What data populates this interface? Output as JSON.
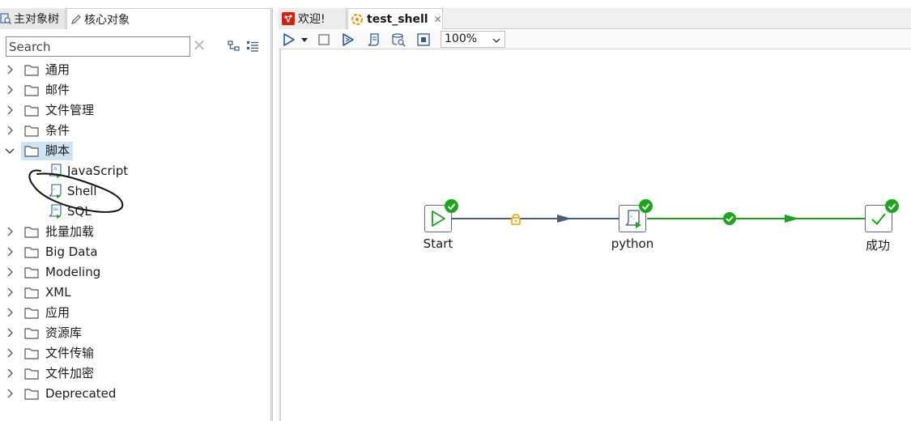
{
  "left_panel": {
    "tabs": [
      {
        "label": "主对象树",
        "icon": "tree-search-icon"
      },
      {
        "label": "核心对象",
        "icon": "pencil-icon"
      }
    ],
    "search": {
      "placeholder": "Search",
      "value": ""
    },
    "tree": [
      {
        "label": "通用",
        "expanded": false
      },
      {
        "label": "邮件",
        "expanded": false
      },
      {
        "label": "文件管理",
        "expanded": false
      },
      {
        "label": "条件",
        "expanded": false
      },
      {
        "label": "脚本",
        "expanded": true,
        "selected": true,
        "children": [
          {
            "label": "JavaScript",
            "icon": "javascript-script-icon"
          },
          {
            "label": "Shell",
            "icon": "shell-script-icon"
          },
          {
            "label": "SQL",
            "icon": "sql-script-icon"
          }
        ]
      },
      {
        "label": "批量加载",
        "expanded": false
      },
      {
        "label": "Big Data",
        "expanded": false
      },
      {
        "label": "Modeling",
        "expanded": false
      },
      {
        "label": "XML",
        "expanded": false
      },
      {
        "label": "应用",
        "expanded": false
      },
      {
        "label": "资源库",
        "expanded": false
      },
      {
        "label": "文件传输",
        "expanded": false
      },
      {
        "label": "文件加密",
        "expanded": false
      },
      {
        "label": "Deprecated",
        "expanded": false
      }
    ]
  },
  "editor": {
    "tabs": [
      {
        "label": "欢迎!",
        "icon": "kettle-welcome-icon",
        "active": false
      },
      {
        "label": "test_shell",
        "icon": "job-icon",
        "active": true,
        "closable": true
      }
    ],
    "toolbar": {
      "zoom": "100%",
      "buttons": [
        "run-icon",
        "run-dropdown-icon",
        "stop-icon",
        "run-preview-icon",
        "script-icon",
        "sql-search-icon",
        "fit-canvas-icon"
      ]
    },
    "job": {
      "nodes": [
        {
          "id": "start",
          "label": "Start",
          "icon": "start-play-icon",
          "status": "success"
        },
        {
          "id": "python",
          "label": "python",
          "icon": "shell-script-icon",
          "status": "success"
        },
        {
          "id": "success",
          "label": "成功",
          "icon": "success-check-icon",
          "status": "success"
        }
      ],
      "hops": [
        {
          "from": "start",
          "to": "python",
          "type": "unconditional",
          "color": "#4a6072",
          "marker": "lock-icon"
        },
        {
          "from": "python",
          "to": "success",
          "type": "on-success",
          "color": "#1aa61a",
          "marker": "success-check-icon"
        }
      ]
    }
  },
  "colors": {
    "selection": "#cce4f7",
    "success_green": "#1aa61a",
    "unconditional_hop": "#4a6072",
    "lock_orange": "#f0a000",
    "annotation_ink": "#111111"
  }
}
